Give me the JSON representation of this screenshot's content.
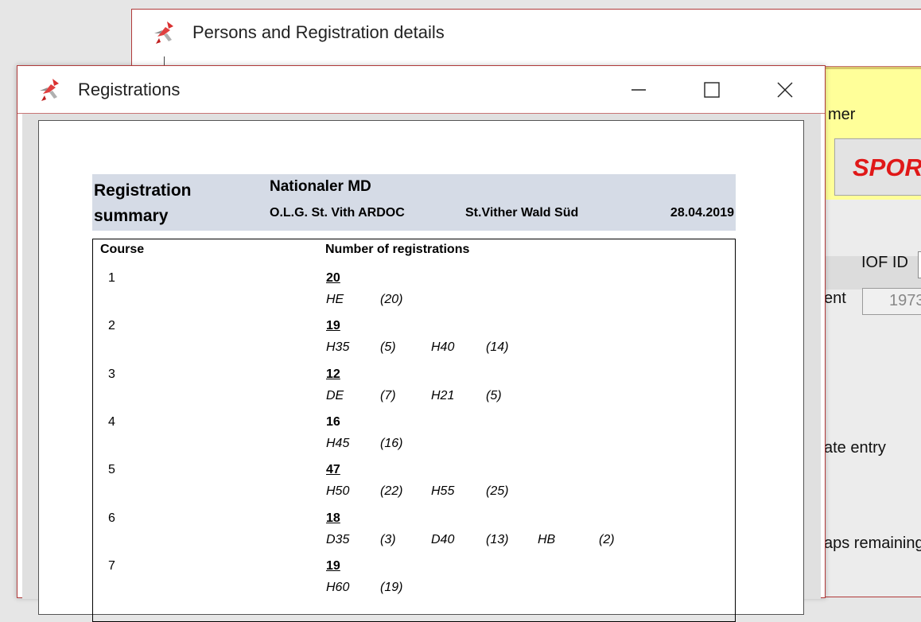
{
  "background_window": {
    "title": "Persons and Registration details",
    "labels": {
      "mer": "mer",
      "sport": "SPOR",
      "iof_id": "IOF ID",
      "ent": "ent",
      "year_value": "1973",
      "late_entry": "ate entry",
      "maps_remaining": "aps remaining"
    },
    "colors": {
      "highlight": "#ffff99",
      "sport_text": "#e01818"
    }
  },
  "front_window": {
    "title": "Registrations",
    "controls": {
      "minimize": "minimize-icon",
      "maximize": "maximize-icon",
      "close": "close-icon"
    }
  },
  "report": {
    "header": {
      "title_line1": "Registration",
      "title_line2": "summary",
      "event": "Nationaler MD",
      "club": "O.L.G. St. Vith ARDOC",
      "map": "St.Vither Wald Süd",
      "date": "28.04.2019"
    },
    "columns": {
      "course": "Course",
      "registrations": "Number of registrations"
    },
    "courses": [
      {
        "course": "1",
        "total": "20",
        "underline": true,
        "classes": [
          {
            "name": "HE",
            "count": "(20)"
          }
        ]
      },
      {
        "course": "2",
        "total": "19",
        "underline": true,
        "classes": [
          {
            "name": "H35",
            "count": "(5)"
          },
          {
            "name": "H40",
            "count": "(14)"
          }
        ]
      },
      {
        "course": "3",
        "total": "12",
        "underline": true,
        "classes": [
          {
            "name": "DE",
            "count": "(7)"
          },
          {
            "name": "H21",
            "count": "(5)"
          }
        ]
      },
      {
        "course": "4",
        "total": "16",
        "underline": false,
        "classes": [
          {
            "name": "H45",
            "count": "(16)"
          }
        ]
      },
      {
        "course": "5",
        "total": "47",
        "underline": true,
        "classes": [
          {
            "name": "H50",
            "count": "(22)"
          },
          {
            "name": "H55",
            "count": "(25)"
          }
        ]
      },
      {
        "course": "6",
        "total": "18",
        "underline": true,
        "classes": [
          {
            "name": "D35",
            "count": "(3)"
          },
          {
            "name": "D40",
            "count": "(13)"
          },
          {
            "name": "HB",
            "count": "(2)"
          }
        ]
      },
      {
        "course": "7",
        "total": "19",
        "underline": true,
        "classes": [
          {
            "name": "H60",
            "count": "(19)"
          }
        ]
      }
    ]
  }
}
